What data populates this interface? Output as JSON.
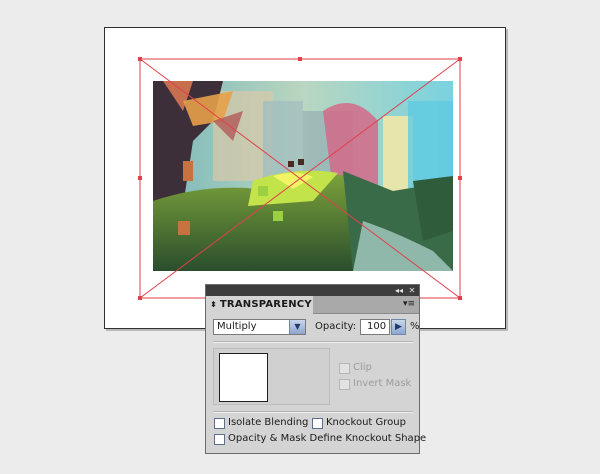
{
  "panel": {
    "title": "TRANSPARENCY",
    "collapse_icon": "double-left-arrow",
    "close_icon": "close-x",
    "menu_icon": "panel-menu",
    "blend_mode": "Multiply",
    "opacity_label": "Opacity:",
    "opacity_value": "100",
    "opacity_unit": "%",
    "clip_label": "Clip",
    "invert_mask_label": "Invert Mask",
    "isolate_blending_label": "Isolate Blending",
    "knockout_group_label": "Knockout Group",
    "opacity_mask_label": "Opacity & Mask Define Knockout Shape",
    "checkboxes": {
      "clip": false,
      "invert_mask": false,
      "isolate_blending": false,
      "knockout_group": false,
      "opacity_mask": false
    }
  },
  "colors": {
    "selection": "#e0404b",
    "workspace": "#ececec",
    "panel_bg": "#d4d4d4",
    "titlebar": "#3d3d3d"
  }
}
